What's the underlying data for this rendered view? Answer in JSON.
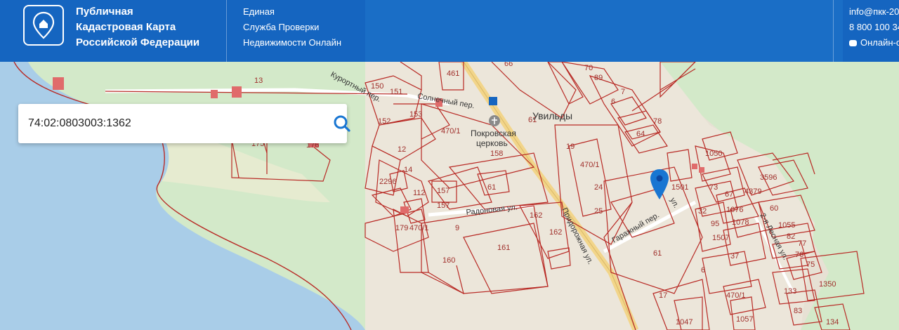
{
  "header": {
    "brand_lines": [
      "Публичная",
      "Кадастровая Карта",
      "Российской Федерации"
    ],
    "service_lines": [
      "Единая",
      "Служба Проверки",
      "Недвижимости Онлайн"
    ],
    "email": "info@пкк-20",
    "phone": "8 800 100 34",
    "online": "Онлайн-о"
  },
  "search": {
    "value": "74:02:0803003:1362",
    "icon": "search-icon"
  },
  "map": {
    "place_name": "Увильды",
    "church": [
      "Покровская",
      "церковь"
    ],
    "streets": [
      "Курортный пер.",
      "Солнечный пер.",
      "Радоновая ул.",
      "Придорожная ул.",
      "Гаражный пер.",
      "2-я Лесная ул.",
      "ул."
    ],
    "parcel_labels": [
      "13",
      "150",
      "151",
      "153",
      "152",
      "461",
      "66",
      "70",
      "89",
      "7",
      "6",
      "64",
      "78",
      "470/1",
      "158",
      "61",
      "19",
      "470/1",
      "24",
      "25",
      "12",
      "14",
      "2296",
      "112",
      "157",
      "157",
      "61",
      "162",
      "162",
      "179",
      "470/1",
      "9",
      "160",
      "161",
      "176",
      "175",
      "1050",
      "1501",
      "73",
      "67",
      "4379",
      "3596",
      "60",
      "32",
      "1076",
      "95",
      "1078",
      "1507",
      "1055",
      "82",
      "77",
      "76",
      "75",
      "37",
      "61",
      "6",
      "1350",
      "17",
      "470/1",
      "133",
      "83",
      "1047",
      "1057",
      "134"
    ]
  },
  "colors": {
    "header_bg": "#1565c0",
    "water": "#a9cde8",
    "forest": "#cfe8c6",
    "parcel_line": "#b82a25",
    "pin": "#1976d2"
  }
}
